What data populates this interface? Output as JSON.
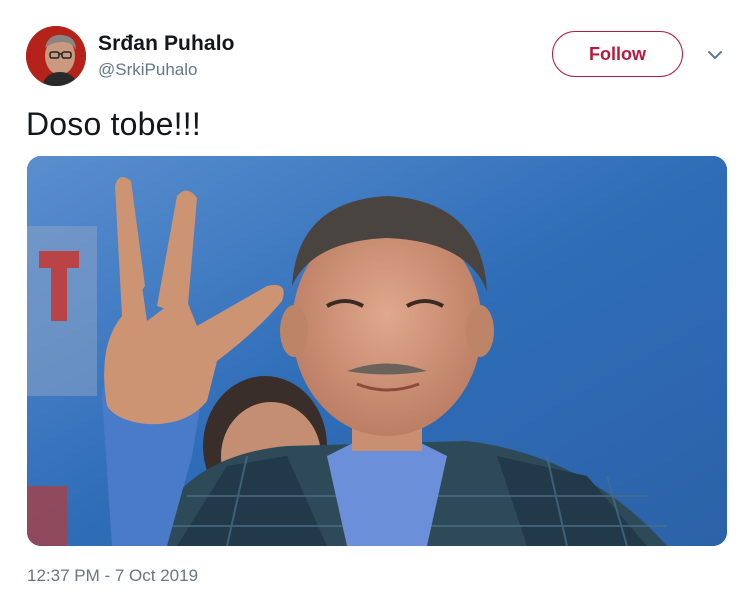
{
  "tweet": {
    "author_name": "Srđan Puhalo",
    "author_handle": "@SrkiPuhalo",
    "follow_label": "Follow",
    "text": "Doso tobe!!!",
    "timestamp": "12:37 PM - 7 Oct 2019"
  },
  "icons": {
    "menu": "chevron-down-icon"
  },
  "colors": {
    "follow_accent": "#b31b3f",
    "secondary_text": "#657786",
    "primary_text": "#14171a"
  }
}
